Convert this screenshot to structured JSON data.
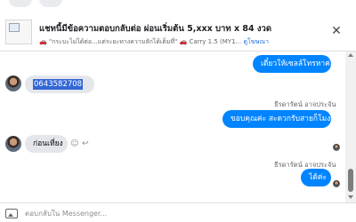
{
  "banner": {
    "title": "แชทนี้มีข้อความตอบกลับต่อ ผ่อนเริ่มต้น 5,xxx บาท x 84 งวด",
    "subtitle": "\"กระบะไม่ได้ต่อ...แต่ระยะทางความลักได้เต็มที่\"",
    "car_text": "Carry 1.5 (MY1...",
    "ad_link": "ดูโฆษณา"
  },
  "messages": {
    "m1": "เดี๋ยวให้เซลล์โทรหาค่ะ",
    "m2": "0643582708",
    "sender1": "ธีรดารัตน์ อาจประจัน",
    "m3": "ขอบคุณค่ะ สะดวกรับสายก็โมงดีคะ",
    "m4": "ก่อนเที่ยง",
    "sender2": "ธีรดารัตน์ อาจประจัน",
    "m5": "ได้ค่ะ"
  },
  "composer": {
    "placeholder": "ตอบกลับใน Messenger..."
  }
}
